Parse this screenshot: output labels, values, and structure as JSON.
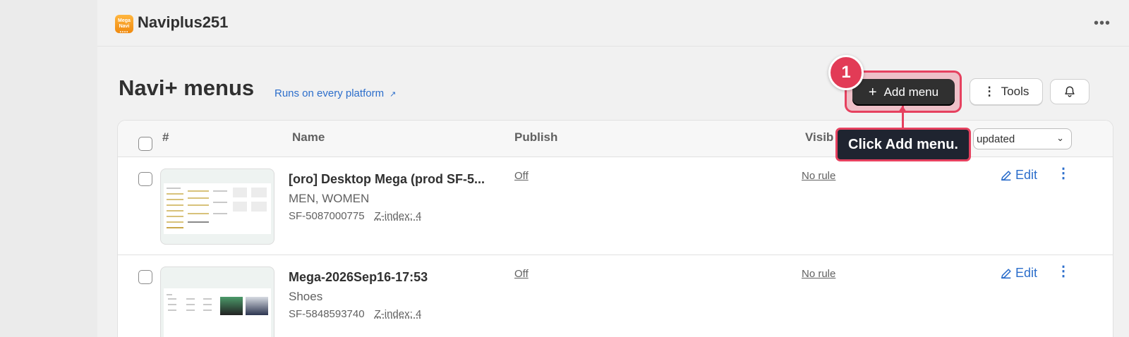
{
  "app": {
    "name": "Naviplus251",
    "logo_text": "Mega\nNavi"
  },
  "page": {
    "title": "Navi+ menus",
    "platform_link": "Runs on every platform"
  },
  "actions": {
    "add_menu_label": "Add menu",
    "tools_label": "Tools"
  },
  "guide": {
    "step_number": "1",
    "tooltip_text": "Click Add menu."
  },
  "table": {
    "headers": {
      "index": "#",
      "name": "Name",
      "publish": "Publish",
      "visibility": "Visib"
    },
    "sort_value": "updated",
    "rows": [
      {
        "name": "[oro] Desktop Mega (prod SF-5...",
        "subtitle": "MEN, WOMEN",
        "id": "SF-5087000775",
        "zindex": "Z-index: 4",
        "publish": "Off",
        "visibility": "No rule",
        "edit_label": "Edit"
      },
      {
        "name": "Mega-2026Sep16-17:53",
        "subtitle": "Shoes",
        "id": "SF-5848593740",
        "zindex": "Z-index: 4",
        "publish": "Off",
        "visibility": "No rule",
        "edit_label": "Edit"
      }
    ]
  },
  "icons": {
    "more": "ellipsis-icon",
    "plus": "plus-icon",
    "tools": "vertical-dots-icon",
    "bell": "bell-icon",
    "edit": "pencil-icon",
    "external": "external-link-icon"
  },
  "colors": {
    "accent": "#2c6ecb",
    "primary_button": "#303030",
    "guide_highlight": "#e6415f",
    "tooltip_bg": "#1f2430"
  }
}
